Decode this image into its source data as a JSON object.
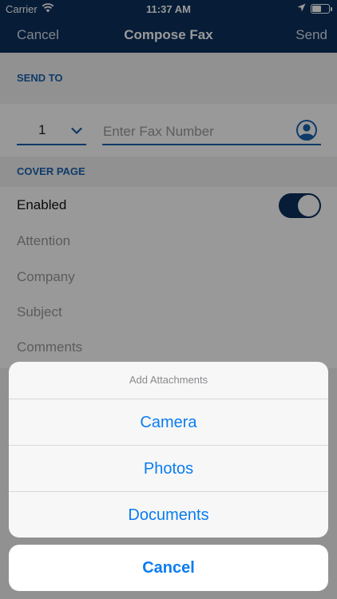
{
  "status_bar": {
    "carrier": "Carrier",
    "time": "11:37 AM"
  },
  "nav": {
    "cancel_label": "Cancel",
    "title": "Compose Fax",
    "send_label": "Send"
  },
  "send_to": {
    "header": "SEND TO",
    "country_code": "1",
    "fax_placeholder": "Enter Fax Number"
  },
  "cover_page": {
    "header": "COVER PAGE",
    "enabled_label": "Enabled",
    "enabled": true,
    "fields": [
      "Attention",
      "Company",
      "Subject",
      "Comments"
    ]
  },
  "action_sheet": {
    "title": "Add Attachments",
    "options": [
      "Camera",
      "Photos",
      "Documents"
    ],
    "cancel_label": "Cancel"
  },
  "colors": {
    "nav_background": "#0a2f5c",
    "accent": "#1a63b0",
    "action_text": "#0a7cf0"
  },
  "icons": {
    "wifi": "wifi-icon",
    "location": "location-arrow-icon",
    "battery": "battery-icon",
    "chevron": "chevron-down-icon",
    "contact": "contact-person-icon"
  }
}
